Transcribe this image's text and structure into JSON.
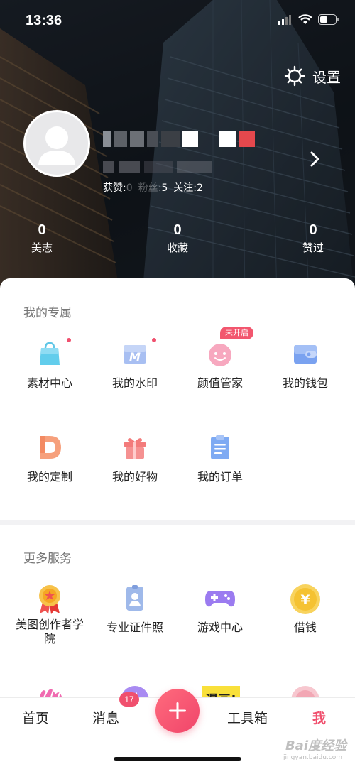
{
  "status_bar": {
    "time": "13:36"
  },
  "header": {
    "settings_label": "设置",
    "stats": {
      "likes_label": "获赞:",
      "likes_value": "0",
      "fans_label": "粉丝:",
      "fans_value": "5",
      "follow_label": "关注:",
      "follow_value": "2"
    }
  },
  "counts": [
    {
      "value": "0",
      "label": "美志"
    },
    {
      "value": "0",
      "label": "收藏"
    },
    {
      "value": "0",
      "label": "赞过"
    }
  ],
  "mine": {
    "title": "我的专属",
    "items": [
      {
        "label": "素材中心",
        "icon": "shopping-bag-icon",
        "dot": true
      },
      {
        "label": "我的水印",
        "icon": "watermark-icon",
        "dot": true
      },
      {
        "label": "颜值管家",
        "icon": "beauty-face-icon",
        "tag": "未开启"
      },
      {
        "label": "我的钱包",
        "icon": "wallet-icon"
      },
      {
        "label": "我的定制",
        "icon": "custom-d-icon"
      },
      {
        "label": "我的好物",
        "icon": "gift-icon"
      },
      {
        "label": "我的订单",
        "icon": "order-list-icon"
      }
    ]
  },
  "more": {
    "title": "更多服务",
    "items": [
      {
        "label": "美图创作者学院",
        "icon": "medal-icon"
      },
      {
        "label": "专业证件照",
        "icon": "id-photo-icon"
      },
      {
        "label": "游戏中心",
        "icon": "gamepad-icon"
      },
      {
        "label": "借钱",
        "icon": "yuan-coin-icon"
      }
    ],
    "partial_badge_text": "漫画!"
  },
  "tabbar": {
    "home": "首页",
    "messages": "消息",
    "messages_badge": "17",
    "toolbox": "工具箱",
    "me": "我"
  },
  "watermark": {
    "main": "Bai度经验",
    "sub": "jingyan.baidu.com"
  },
  "colors": {
    "accent": "#f0506e",
    "hero_bg": "#141a20"
  }
}
